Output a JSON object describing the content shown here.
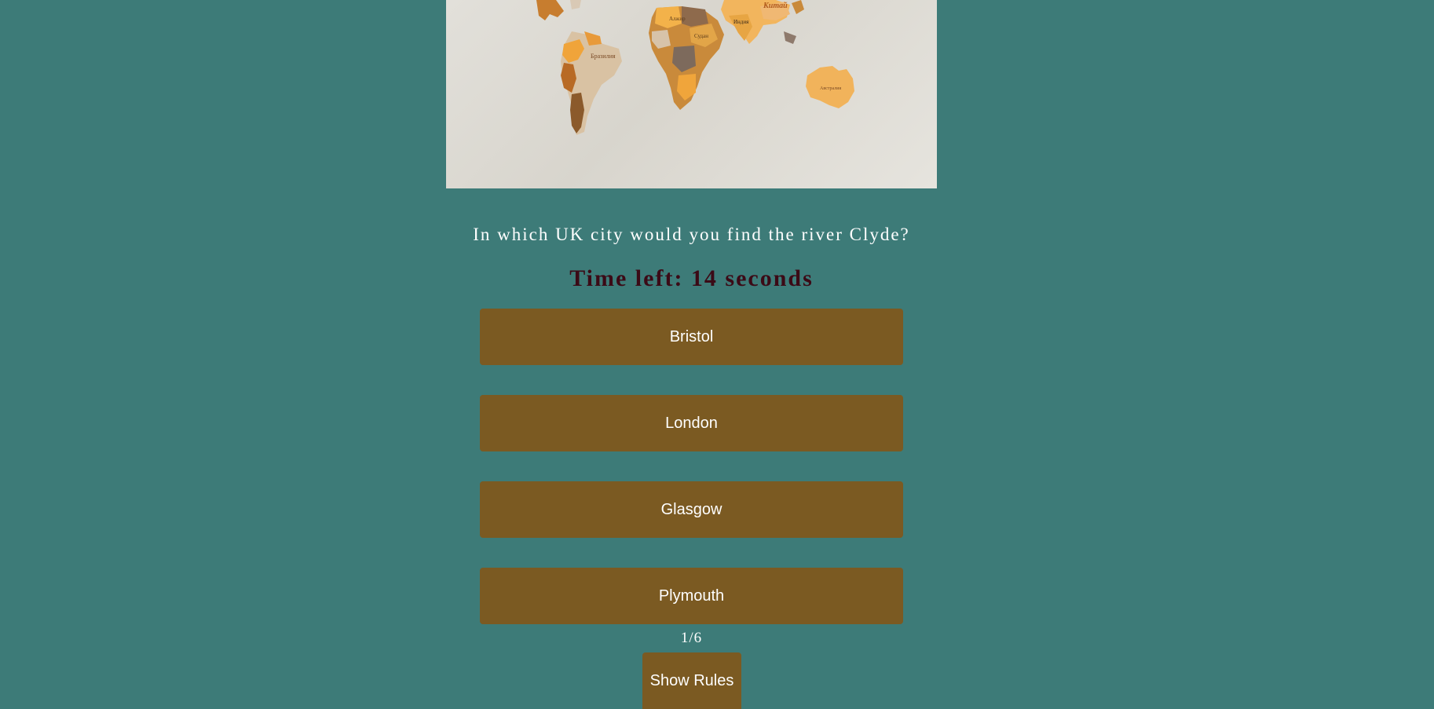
{
  "quiz": {
    "image_alt": "World map made of wooden puzzle pieces",
    "map_labels": {
      "china": "Китай",
      "brazil": "Бразилия",
      "algeria": "Алжир",
      "sudan": "Судан",
      "india": "Индия",
      "australia": "Австралия"
    },
    "question": "In which UK city would you find the river Clyde?",
    "timer_text": "Time left: 14 seconds",
    "answers": [
      "Bristol",
      "London",
      "Glasgow",
      "Plymouth"
    ],
    "progress": "1/6",
    "rules_button": "Show Rules"
  },
  "colors": {
    "background": "#3d7b78",
    "button": "#7b5a22",
    "timer": "#3b0a16",
    "text": "#ffffff"
  }
}
